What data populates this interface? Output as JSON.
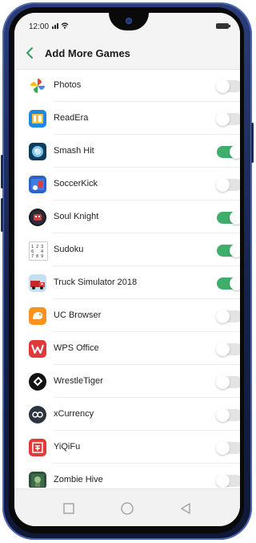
{
  "status": {
    "time": "12:00",
    "signal_wifi": "☷…"
  },
  "header": {
    "title": "Add More Games"
  },
  "apps": [
    {
      "label": "Photos",
      "icon": "photos-icon",
      "enabled": false
    },
    {
      "label": "ReadEra",
      "icon": "readera-icon",
      "enabled": false
    },
    {
      "label": "Smash Hit",
      "icon": "smash-hit-icon",
      "enabled": true
    },
    {
      "label": "SoccerKick",
      "icon": "soccerkick-icon",
      "enabled": false
    },
    {
      "label": "Soul Knight",
      "icon": "soul-knight-icon",
      "enabled": true
    },
    {
      "label": "Sudoku",
      "icon": "sudoku-icon",
      "enabled": true
    },
    {
      "label": "Truck Simulator 2018",
      "icon": "truck-simulator-icon",
      "enabled": true
    },
    {
      "label": "UC Browser",
      "icon": "uc-browser-icon",
      "enabled": false
    },
    {
      "label": "WPS Office",
      "icon": "wps-office-icon",
      "enabled": false
    },
    {
      "label": "WrestleTiger",
      "icon": "wrestletiger-icon",
      "enabled": false
    },
    {
      "label": "xCurrency",
      "icon": "xcurrency-icon",
      "enabled": false
    },
    {
      "label": "YiQiFu",
      "icon": "yiqifu-icon",
      "enabled": false
    },
    {
      "label": "Zombie Hive",
      "icon": "zombie-hive-icon",
      "enabled": false
    }
  ],
  "colors": {
    "toggle_on": "#3fae6a",
    "toggle_off": "#e3e3e3",
    "accent_back": "#2e9f5c"
  },
  "navbar": {
    "icons": [
      "recent-apps-icon",
      "home-icon",
      "back-nav-icon"
    ]
  }
}
